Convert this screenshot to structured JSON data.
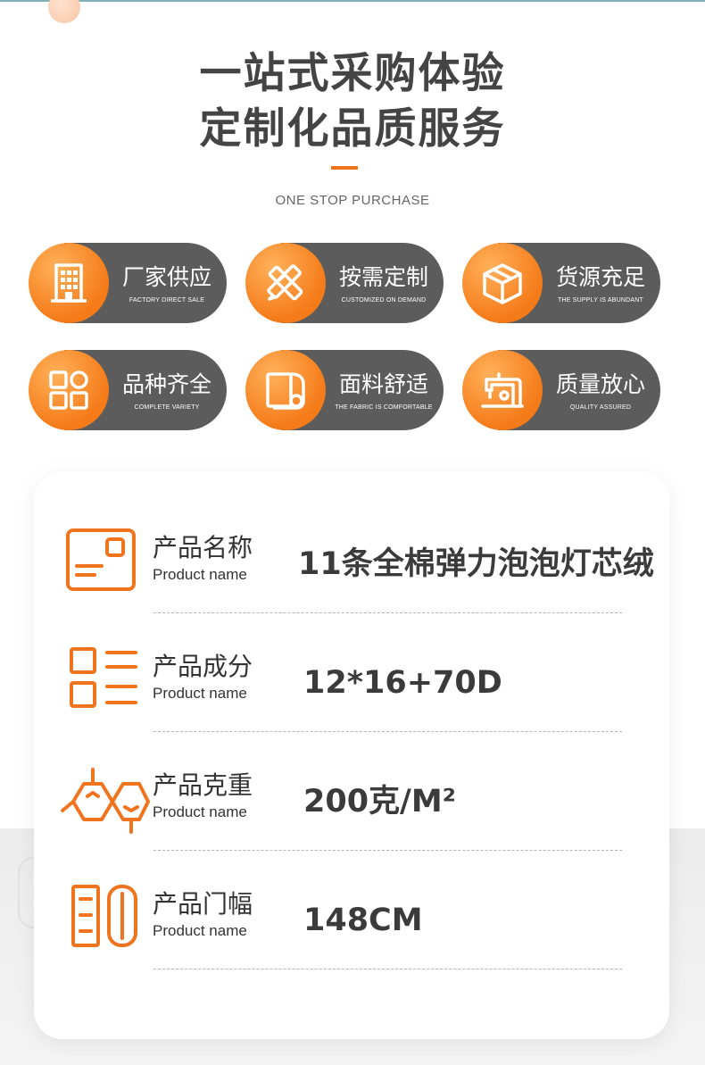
{
  "header": {
    "title_line1": "一站式采购体验",
    "title_line2": "定制化品质服务",
    "subtitle": "ONE STOP PURCHASE"
  },
  "features": [
    {
      "title": "厂家供应",
      "subtitle": "FACTORY DIRECT SALE",
      "icon": "building-icon"
    },
    {
      "title": "按需定制",
      "subtitle": "CUSTOMIZED ON DEMAND",
      "icon": "pencil-ruler-icon"
    },
    {
      "title": "货源充足",
      "subtitle": "THE SUPPLY IS ABUNDANT",
      "icon": "box-icon"
    },
    {
      "title": "品种齐全",
      "subtitle": "COMPLETE VARIETY",
      "icon": "grid-icon"
    },
    {
      "title": "面料舒适",
      "subtitle": "THE FABRIC IS COMFORTABLE",
      "icon": "fabric-roll-icon"
    },
    {
      "title": "质量放心",
      "subtitle": "QUALITY ASSURED",
      "icon": "sewing-machine-icon"
    }
  ],
  "specs": [
    {
      "label": "产品名称",
      "label_en": "Product name",
      "value": "11条全棉弹力泡泡灯芯绒",
      "icon": "id-card-icon"
    },
    {
      "label": "产品成分",
      "label_en": "Product name",
      "value": "12*16+70D",
      "icon": "list-icon"
    },
    {
      "label": "产品克重",
      "label_en": "Product name",
      "value": "200克/M²",
      "icon": "molecule-icon"
    },
    {
      "label": "产品门幅",
      "label_en": "Product name",
      "value": "148CM",
      "icon": "panels-icon"
    }
  ],
  "colors": {
    "accent": "#f0741e",
    "pill": "#5c5c5c",
    "text": "#333333"
  }
}
